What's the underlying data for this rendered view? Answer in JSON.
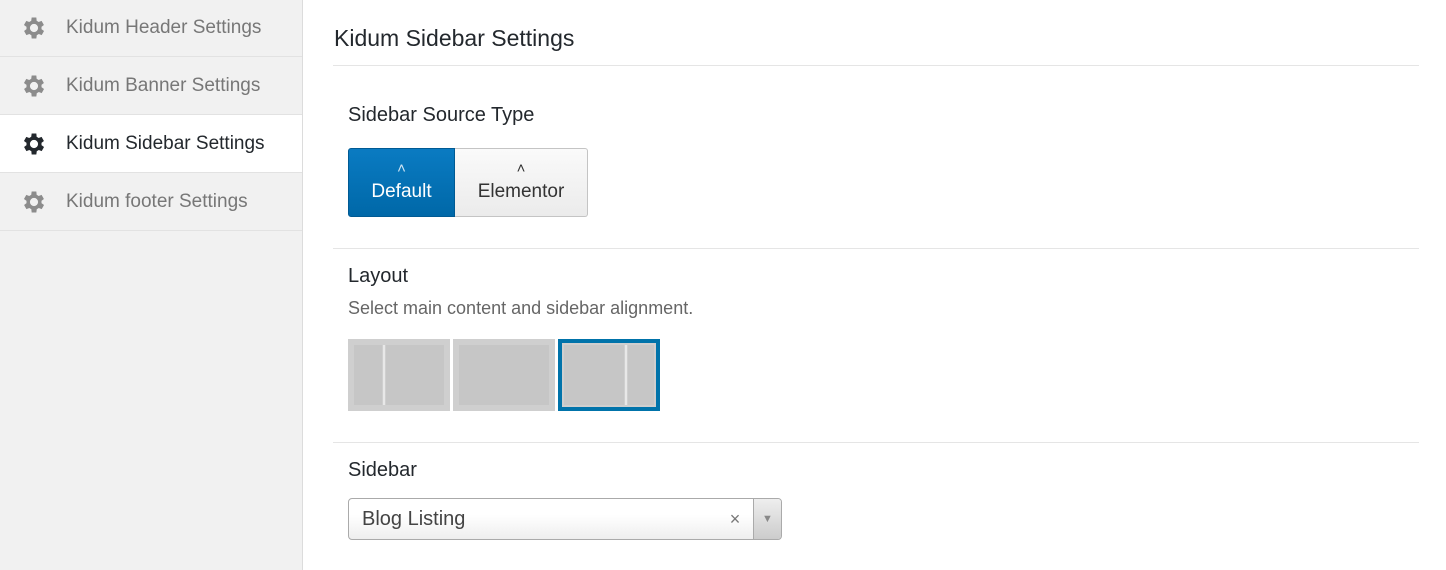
{
  "sidebar": {
    "items": [
      {
        "label": "Kidum Header Settings",
        "icon": "gear-icon"
      },
      {
        "label": "Kidum Banner Settings",
        "icon": "gear-icon"
      },
      {
        "label": "Kidum Sidebar Settings",
        "icon": "gear-icon",
        "active": true
      },
      {
        "label": "Kidum footer Settings",
        "icon": "gear-icon"
      }
    ]
  },
  "main": {
    "title": "Kidum Sidebar Settings",
    "source_type": {
      "label": "Sidebar Source Type",
      "options": [
        "Default",
        "Elementor"
      ],
      "selected": "Default"
    },
    "layout": {
      "label": "Layout",
      "description": "Select main content and sidebar alignment.",
      "options": [
        "left-sidebar",
        "full-width",
        "right-sidebar"
      ],
      "selected": "right-sidebar"
    },
    "sidebar_select": {
      "label": "Sidebar",
      "value": "Blog Listing",
      "clear_symbol": "×",
      "arrow_symbol": "▼"
    }
  },
  "colors": {
    "accent": "#0073aa",
    "active_button": "#0a7bc2"
  }
}
